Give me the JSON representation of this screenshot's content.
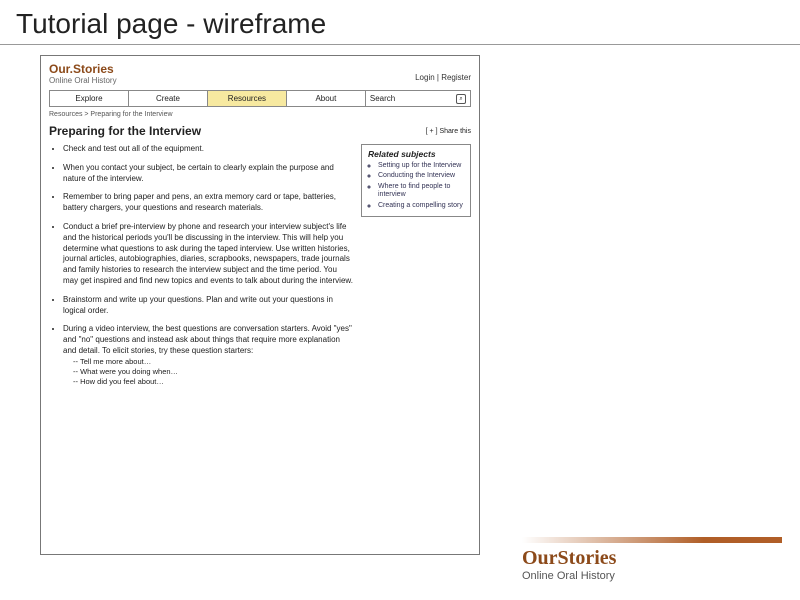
{
  "slide": {
    "title": "Tutorial page - wireframe"
  },
  "wire": {
    "logo": "Our.Stories",
    "tagline": "Online Oral History",
    "login": "Login | Register",
    "nav": {
      "explore": "Explore",
      "create": "Create",
      "resources": "Resources",
      "about": "About",
      "search": "Search"
    },
    "crumb": "Resources > Preparing for the Interview",
    "h1": "Preparing for the Interview",
    "share": "[ + ] Share this",
    "bullets": [
      "Check and test out all of the equipment.",
      "When you contact your subject, be certain to clearly explain the purpose and nature of the interview.",
      "Remember to bring paper and pens, an extra memory card or tape, batteries, battery chargers, your questions and research materials.",
      "Conduct a brief pre-interview by phone and research your interview subject's life and the historical periods you'll be discussing in the interview. This will help you determine what questions to ask during the taped interview. Use written histories, journal articles, autobiographies, diaries, scrapbooks, newspapers, trade journals and family histories to research the interview subject and the time period. You may get inspired and find new topics and events to talk about during the interview.",
      "Brainstorm and write up your questions. Plan and write out your questions in logical order.",
      "During a video interview, the best questions are conversation starters. Avoid \"yes\" and \"no\" questions and instead ask about things that require more explanation and detail. To elicit stories, try these question starters:"
    ],
    "starters": [
      "-- Tell me more about…",
      "-- What were you doing when…",
      "-- How did you feel about…"
    ],
    "related": {
      "title": "Related subjects",
      "items": [
        "Setting up for the Interview",
        "Conducting the Interview",
        "Where to find people to interview",
        "Creating a compelling story"
      ]
    }
  },
  "brand": {
    "name": "OurStories",
    "tag": "Online Oral History"
  }
}
